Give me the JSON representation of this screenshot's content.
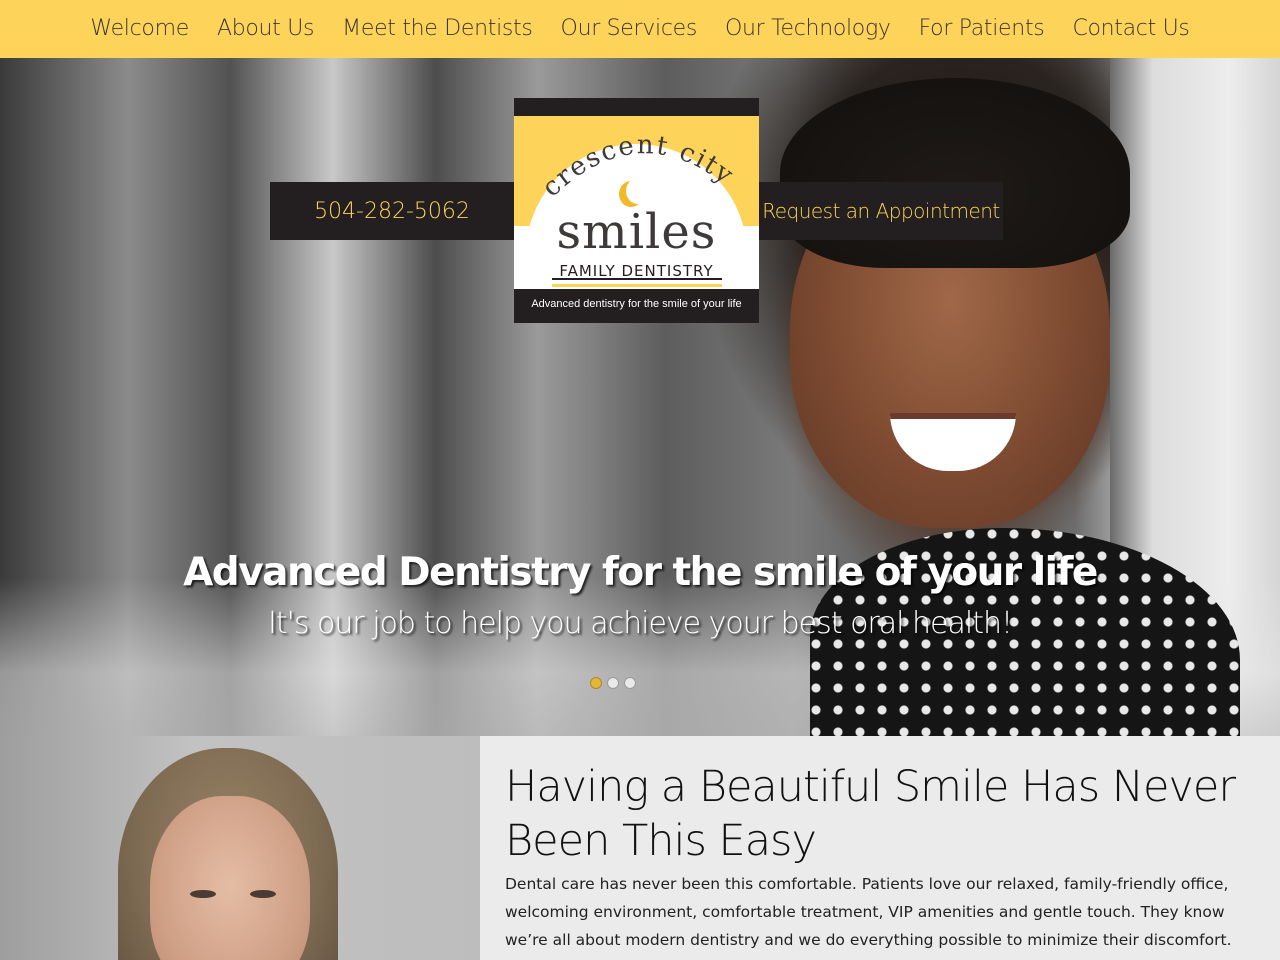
{
  "nav": {
    "items": [
      {
        "label": "Welcome"
      },
      {
        "label": "About Us"
      },
      {
        "label": "Meet the Dentists"
      },
      {
        "label": "Our Services"
      },
      {
        "label": "Our Technology"
      },
      {
        "label": "For Patients"
      },
      {
        "label": "Contact Us"
      }
    ]
  },
  "hero": {
    "phone": "504-282-5062",
    "appointment": "Request an Appointment",
    "logo": {
      "curved_text": "crescent city",
      "name": "smiles",
      "subtitle": "FAMILY DENTISTRY",
      "tagline": "Advanced dentistry for the smile of your life"
    },
    "title": "Advanced Dentistry for the smile of your life",
    "subtitle": "It's our job to help you achieve your best oral health!",
    "slides_count": 3,
    "active_slide": 1
  },
  "intro": {
    "heading": "Having a Beautiful Smile Has Never Been This Easy",
    "paragraph": "Dental care has never been this comfortable. Patients love our relaxed, family-friendly office, welcoming environment, comfortable treatment, VIP amenities and gentle touch. They know we’re all about modern dentistry and we do everything possible to minimize their discomfort."
  },
  "colors": {
    "accent": "#fdd35a",
    "dark": "#231f20",
    "text": "#3a3530",
    "active_dot": "#e2b73a"
  }
}
